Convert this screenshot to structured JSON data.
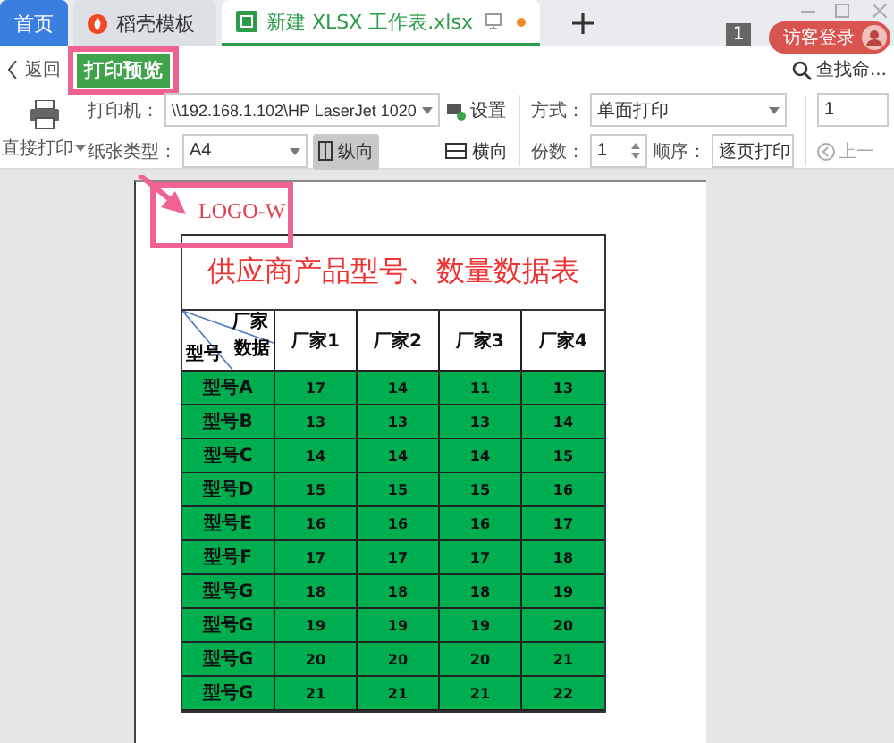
{
  "tabs": [
    {
      "kind": "home",
      "label": "首页",
      "selected": false
    },
    {
      "kind": "template",
      "label": "稻壳模板",
      "selected": false
    },
    {
      "kind": "sheet",
      "label": "新建 XLSX 工作表.xlsx",
      "selected": true
    }
  ],
  "window_count": "1",
  "login": "访客登录",
  "nav": {
    "back": "返回",
    "title": "打印预览",
    "search": "查找命..."
  },
  "toolbar": {
    "direct_print": "直接打印",
    "printer_label": "打印机：",
    "printer": "\\\\192.168.1.102\\HP LaserJet 1020",
    "settings": "设置",
    "paper_label": "纸张类型：",
    "paper": "A4",
    "orientation": [
      {
        "label": "纵向",
        "selected": true
      },
      {
        "label": "横向",
        "selected": false
      }
    ],
    "mode_label": "方式：",
    "mode": "单面打印",
    "copies_label": "份数：",
    "copies": "1",
    "order_label": "顺序：",
    "order": "逐页打印",
    "page": "1",
    "prev": "上一"
  },
  "sheet": {
    "logo": "LOGO-W",
    "title": "供应商产品型号、数量数据表",
    "corner": {
      "top": "厂家",
      "middle": "数据",
      "bottom": "型号"
    },
    "columns": [
      "厂家1",
      "厂家2",
      "厂家3",
      "厂家4"
    ],
    "rows": [
      {
        "label": "型号A",
        "values": [
          "17",
          "14",
          "11",
          "13"
        ]
      },
      {
        "label": "型号B",
        "values": [
          "13",
          "13",
          "13",
          "14"
        ]
      },
      {
        "label": "型号C",
        "values": [
          "14",
          "14",
          "14",
          "15"
        ]
      },
      {
        "label": "型号D",
        "values": [
          "15",
          "15",
          "15",
          "16"
        ]
      },
      {
        "label": "型号E",
        "values": [
          "16",
          "16",
          "16",
          "17"
        ]
      },
      {
        "label": "型号F",
        "values": [
          "17",
          "17",
          "17",
          "18"
        ]
      },
      {
        "label": "型号G",
        "values": [
          "18",
          "18",
          "18",
          "19"
        ]
      },
      {
        "label": "型号G",
        "values": [
          "19",
          "19",
          "19",
          "20"
        ]
      },
      {
        "label": "型号G",
        "values": [
          "20",
          "20",
          "20",
          "21"
        ]
      },
      {
        "label": "型号G",
        "values": [
          "21",
          "21",
          "21",
          "22"
        ]
      }
    ]
  }
}
